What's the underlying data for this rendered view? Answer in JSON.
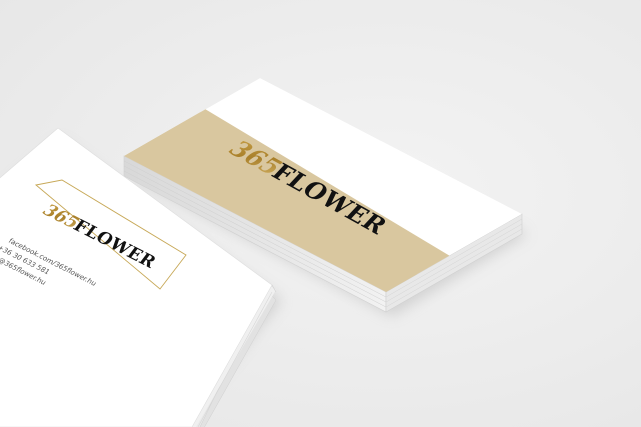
{
  "brand": {
    "number": "365",
    "name": "FLOWER"
  },
  "contact": {
    "facebook": "facebook.com/365flower.hu",
    "phone": "+36 30 633 581",
    "email": "info@365flower.hu"
  },
  "colors": {
    "background": "#ededed",
    "card_white": "#ffffff",
    "card_beige": "#d9c79f",
    "gold": "#b48a2e",
    "black": "#111111"
  }
}
